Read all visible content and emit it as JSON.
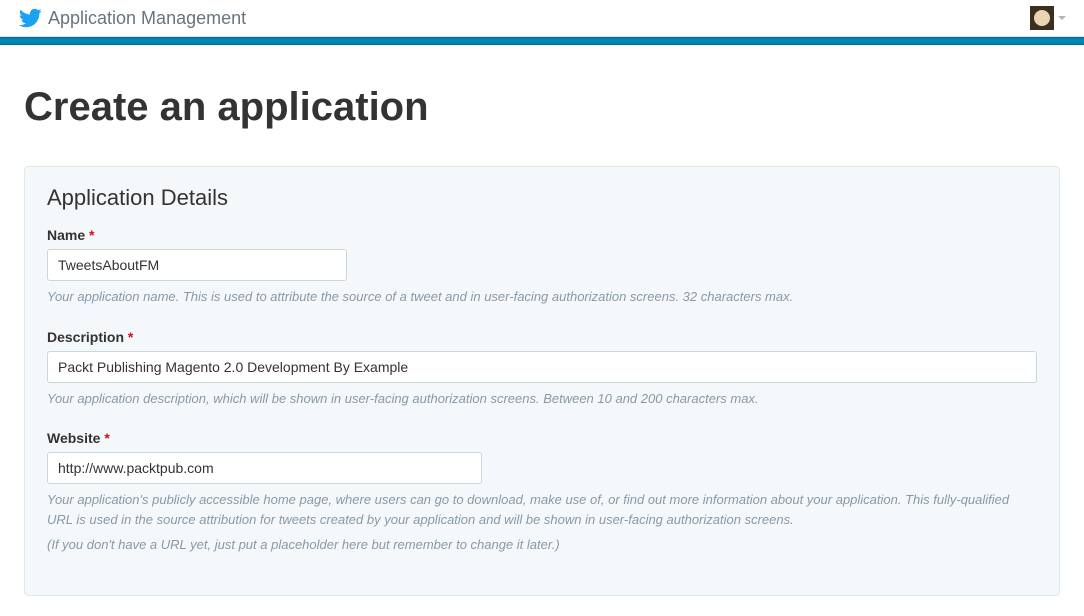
{
  "header": {
    "title": "Application Management"
  },
  "page": {
    "title": "Create an application"
  },
  "panel": {
    "heading": "Application Details",
    "required_mark": "*"
  },
  "fields": {
    "name": {
      "label": "Name",
      "value": "TweetsAboutFM",
      "help": "Your application name. This is used to attribute the source of a tweet and in user-facing authorization screens. 32 characters max."
    },
    "description": {
      "label": "Description",
      "value": "Packt Publishing Magento 2.0 Development By Example",
      "help": "Your application description, which will be shown in user-facing authorization screens. Between 10 and 200 characters max."
    },
    "website": {
      "label": "Website",
      "value": "http://www.packtpub.com",
      "help1": "Your application's publicly accessible home page, where users can go to download, make use of, or find out more information about your application. This fully-qualified URL is used in the source attribution for tweets created by your application and will be shown in user-facing authorization screens.",
      "help2": "(If you don't have a URL yet, just put a placeholder here but remember to change it later.)"
    }
  }
}
